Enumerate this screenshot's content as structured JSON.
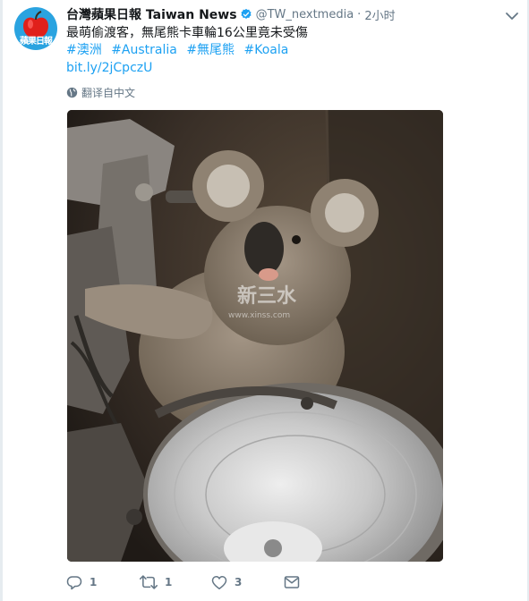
{
  "tweet": {
    "author_name": "台灣蘋果日報 Taiwan News",
    "handle": "@TW_nextmedia",
    "separator": "·",
    "time": "2小时",
    "text": "最萌偷渡客，無尾熊卡車輪16公里竟未受傷",
    "hashtags": [
      "#澳洲",
      "#Australia",
      "#無尾熊",
      "#Koala"
    ],
    "link": "bit.ly/2jCpczU",
    "translate_label": "翻译自中文",
    "avatar_text": "蘋果日報",
    "media_watermark": "新三水",
    "media_watermark_url": "www.xinss.com"
  },
  "actions": {
    "reply_count": "1",
    "retweet_count": "1",
    "like_count": "3"
  },
  "colors": {
    "link": "#1da1f2",
    "muted": "#657786",
    "text": "#14171a",
    "avatar_bg": "#2aa3e0",
    "apple_red": "#e0201b"
  },
  "icons": [
    "verified-badge-icon",
    "caret-down-icon",
    "globe-icon",
    "reply-icon",
    "retweet-icon",
    "like-icon",
    "direct-message-icon"
  ]
}
